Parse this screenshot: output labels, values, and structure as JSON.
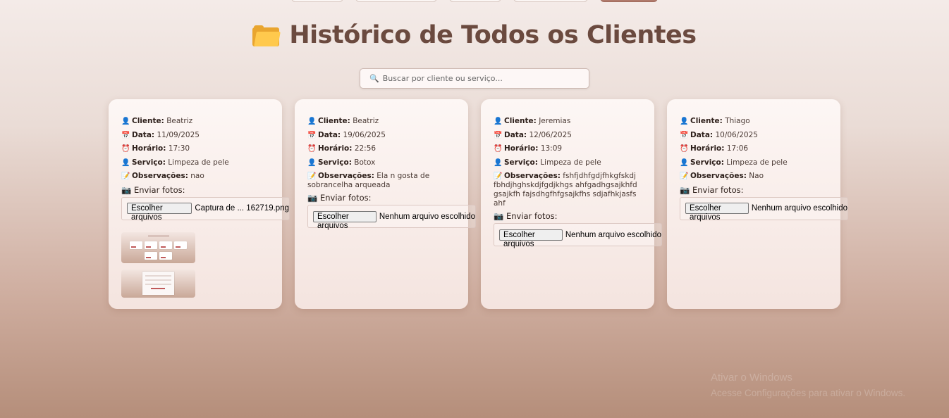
{
  "page": {
    "title": "Histórico de Todos os Clientes",
    "title_icon": "folder-icon"
  },
  "search": {
    "placeholder": "Buscar por cliente ou serviço..."
  },
  "labels": {
    "cliente": "Cliente:",
    "data": "Data:",
    "horario": "Horário:",
    "servico": "Serviço:",
    "observacoes": "Observações:",
    "enviar_fotos": "Enviar fotos:",
    "escolher_arquivos": "Escolher arquivos"
  },
  "cards": [
    {
      "cliente": "Beatriz",
      "data": "11/09/2025",
      "horario": "17:30",
      "servico": "Limpeza de pele",
      "observacoes": "nao",
      "arquivo": "Captura de ... 162719.png"
    },
    {
      "cliente": "Beatriz",
      "data": "19/06/2025",
      "horario": "22:56",
      "servico": "Botox",
      "observacoes": "Ela n gosta de sobrancelha arqueada",
      "arquivo": "Nenhum arquivo escolhido"
    },
    {
      "cliente": "Jeremias",
      "data": "12/06/2025",
      "horario": "13:09",
      "servico": "Limpeza de pele",
      "observacoes": "fshfjdhfgdjfhkgfskdjfbhdjhghskdjfgdjkhgs ahfgadhgsajkhfdgsajkfh fajsdhgfhfgsajkfhs sdjafhkjasfsahf",
      "arquivo": "Nenhum arquivo escolhido"
    },
    {
      "cliente": "Thiago",
      "data": "10/06/2025",
      "horario": "17:06",
      "servico": "Limpeza de pele",
      "observacoes": "Nao",
      "arquivo": "Nenhum arquivo escolhido"
    }
  ],
  "watermark": {
    "line1": "Ativar o Windows",
    "line2": "Acesse Configurações para ativar o Windows."
  }
}
